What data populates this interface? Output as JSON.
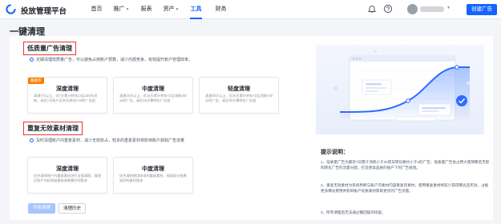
{
  "header": {
    "app_title": "投放管理平台",
    "nav": [
      {
        "label": "首页",
        "has_dropdown": false,
        "active": false
      },
      {
        "label": "推广",
        "has_dropdown": true,
        "active": false
      },
      {
        "label": "报表",
        "has_dropdown": false,
        "active": false
      },
      {
        "label": "资产",
        "has_dropdown": true,
        "active": false
      },
      {
        "label": "工具",
        "has_dropdown": false,
        "active": true
      },
      {
        "label": "财务",
        "has_dropdown": false,
        "active": false
      }
    ],
    "icons": [
      "bell-icon",
      "help-icon"
    ],
    "create_button": "创建广告"
  },
  "page": {
    "title": "一键清理"
  },
  "low_quality": {
    "title": "低质量广告清理",
    "desc": "定期清理低质量广告，可以避免占用账户预算，减少内部竞争，有效提升账户管理效率。",
    "options": [
      {
        "tag": "最推荐",
        "name": "深度清理",
        "desc": "清理7天以上、近7天累计转化≤3且≤50元消耗，或近7天账户近30天转化<10的广告组"
      },
      {
        "tag": "",
        "name": "中度清理",
        "desc": "清理15天以上、近15天累计转化<3且消耗≤50元的广告，或近15天零转化广告组"
      },
      {
        "tag": "",
        "name": "轻度清理",
        "desc": "清理30天以上、近30天累计转化<3且消耗<30元的广告，或近30天零转化广告组"
      }
    ]
  },
  "dup_material": {
    "title": "重复无效素材清理",
    "desc": "及时清理账户内重复素材，减少无效抢占，较多的重复素材将影响账户获取广告流量",
    "options": [
      {
        "tag": "",
        "name": "深度清理",
        "desc": "优先清除账户内重复素材进行全面清理，清理后账户内仅保留素材效果最好的版本"
      },
      {
        "tag": "",
        "name": "中度清理",
        "desc": "优先清除使用较低的重复素材，保留部分效果较好的素材版本"
      }
    ]
  },
  "actions": {
    "start": "开始清理",
    "history": "清理历史"
  },
  "tips": {
    "title": "提示说明：",
    "items": [
      "1、低质量广告为最近7日累计消耗小于20或日转化数约小于3的广告；低质量广告会占用大量预算且无影响转化广告的流量分配，打造更高品质的账户下的广告投放。",
      "2、重复无效素材为系统判断与账户内素材内容重复的素材，使用重复素材将较少获得曝光且无效，占据更多曝光费用并影响账户优质素材获取更优的广告流量。",
      "3、所有清理后无法通过撤回操作恢复。"
    ]
  },
  "colors": {
    "accent": "#1664ff",
    "highlight_border": "#e53935",
    "tag": "#ff7d00"
  }
}
